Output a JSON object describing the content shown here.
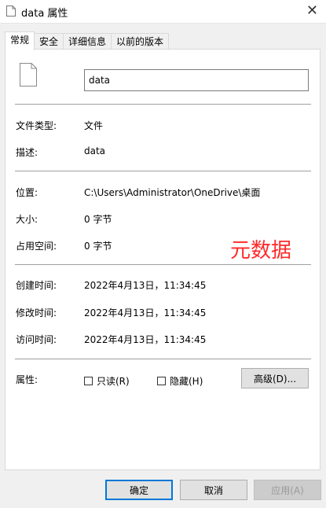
{
  "window": {
    "title": "data 属性",
    "close_glyph": "✕"
  },
  "tabs": [
    {
      "label": "常规",
      "active": true
    },
    {
      "label": "安全",
      "active": false
    },
    {
      "label": "详细信息",
      "active": false
    },
    {
      "label": "以前的版本",
      "active": false
    }
  ],
  "general": {
    "file_name": "data",
    "type_label": "文件类型:",
    "type_value": "文件",
    "desc_label": "描述:",
    "desc_value": "data",
    "location_label": "位置:",
    "location_value": "C:\\Users\\Administrator\\OneDrive\\桌面",
    "size_label": "大小:",
    "size_value": "0 字节",
    "disk_label": "占用空间:",
    "disk_value": "0 字节",
    "created_label": "创建时间:",
    "created_value": "2022年4月13日，11:34:45",
    "modified_label": "修改时间:",
    "modified_value": "2022年4月13日，11:34:45",
    "accessed_label": "访问时间:",
    "accessed_value": "2022年4月13日，11:34:45",
    "attributes_label": "属性:",
    "readonly_label": "只读(R)",
    "hidden_label": "隐藏(H)",
    "advanced_label": "高级(D)...",
    "annotation": "元数据"
  },
  "buttons": {
    "ok": "确定",
    "cancel": "取消",
    "apply": "应用(A)"
  },
  "colors": {
    "annotation": "#ff2a2a",
    "default_button_border": "#0078d7"
  }
}
